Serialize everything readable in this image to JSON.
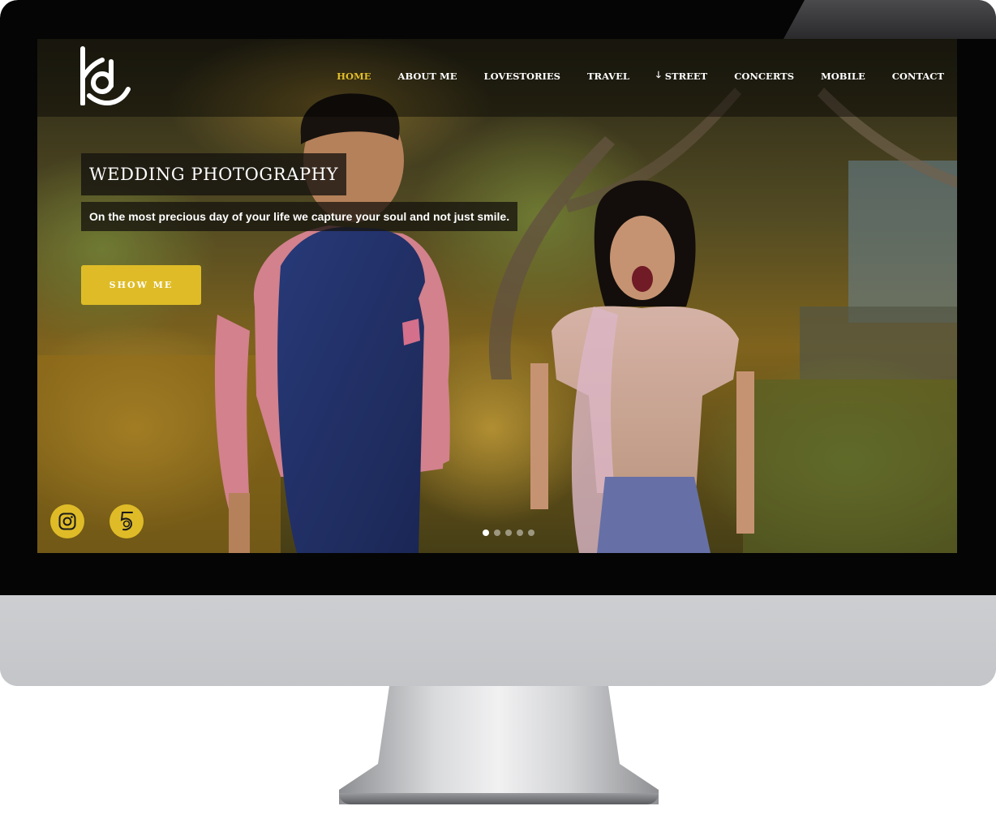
{
  "brand": {
    "logo_icon": "kd-monogram-logo"
  },
  "nav": {
    "items": [
      {
        "label": "HOME",
        "active": true
      },
      {
        "label": "ABOUT ME",
        "active": false
      },
      {
        "label": "LOVESTORIES",
        "active": false
      },
      {
        "label": "TRAVEL",
        "active": false
      },
      {
        "label": "STREET",
        "active": false,
        "icon": "arrow-down-icon"
      },
      {
        "label": "CONCERTS",
        "active": false
      },
      {
        "label": "MOBILE",
        "active": false
      },
      {
        "label": "CONTACT",
        "active": false
      }
    ]
  },
  "hero": {
    "title": "WEDDING PHOTOGRAPHY",
    "subtitle": "On the most precious day of your life we capture your soul and not just smile.",
    "cta_label": "SHOW ME",
    "image_subject": "couple-portrait-photo"
  },
  "social": [
    {
      "icon": "instagram-icon"
    },
    {
      "icon": "500px-icon"
    }
  ],
  "slider": {
    "dot_count": 5,
    "active_index": 0
  },
  "colors": {
    "accent": "#dfbc27",
    "nav_active": "#e2bf2b",
    "text": "#ffffff"
  }
}
